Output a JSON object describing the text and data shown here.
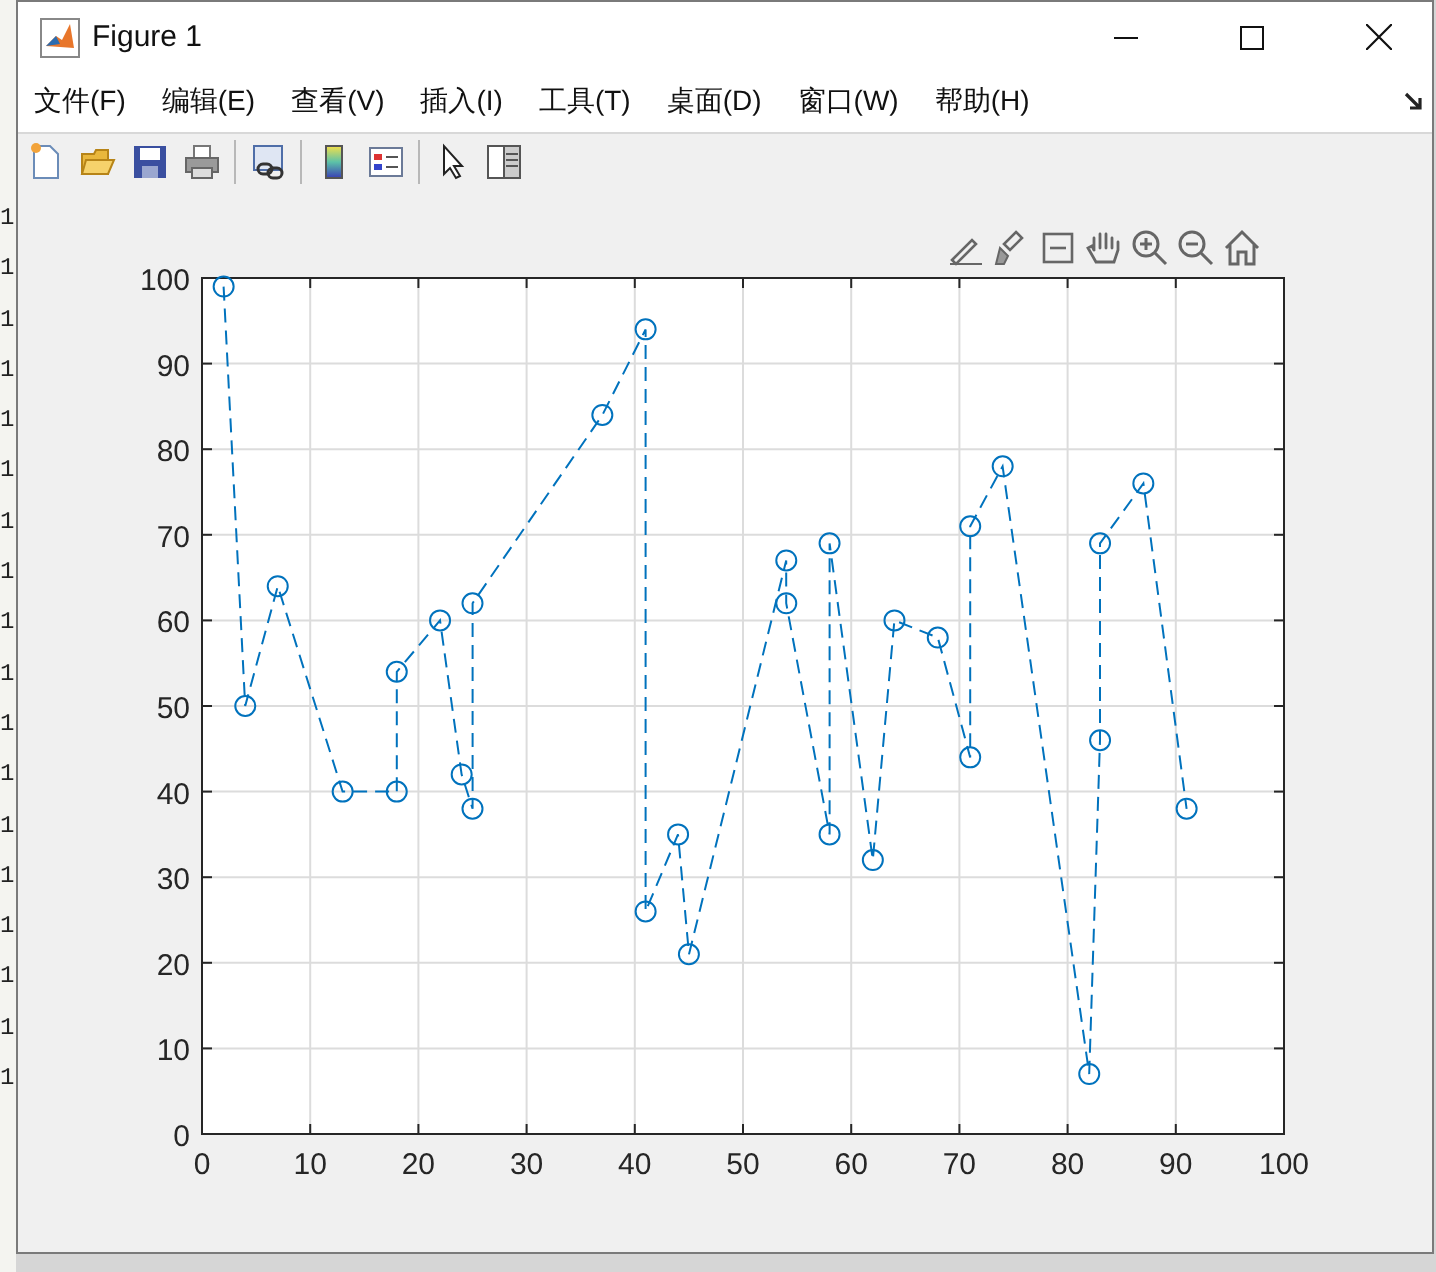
{
  "window": {
    "title": "Figure 1"
  },
  "background_line_numbers": [
    "1",
    "1",
    "1",
    "1",
    "1",
    "1",
    "1",
    "1",
    "1",
    "1",
    "1",
    "1",
    "1",
    "1",
    "1",
    "1",
    "1",
    "1"
  ],
  "menu": [
    "文件(F)",
    "编辑(E)",
    "查看(V)",
    "插入(I)",
    "工具(T)",
    "桌面(D)",
    "窗口(W)",
    "帮助(H)"
  ],
  "chart_data": {
    "type": "line",
    "x": [
      2,
      4,
      7,
      13,
      18,
      18,
      22,
      24,
      25,
      25,
      37,
      41,
      41,
      44,
      45,
      54,
      54,
      58,
      58,
      62,
      64,
      68,
      71,
      71,
      74,
      82,
      83,
      83,
      87,
      91
    ],
    "grid": true,
    "series": [
      {
        "color": "#0072bd",
        "line_style": "dashed",
        "marker": "circle",
        "values": [
          99,
          50,
          64,
          40,
          40,
          54,
          60,
          42,
          38,
          62,
          84,
          94,
          26,
          35,
          21,
          67,
          62,
          35,
          69,
          32,
          60,
          58,
          44,
          71,
          78,
          7,
          46,
          69,
          76,
          38
        ]
      }
    ],
    "xlim": [
      0,
      100
    ],
    "ylim": [
      0,
      100
    ],
    "xticks": [
      0,
      10,
      20,
      30,
      40,
      50,
      60,
      70,
      80,
      90,
      100
    ],
    "yticks": [
      0,
      10,
      20,
      30,
      40,
      50,
      60,
      70,
      80,
      90,
      100
    ]
  }
}
